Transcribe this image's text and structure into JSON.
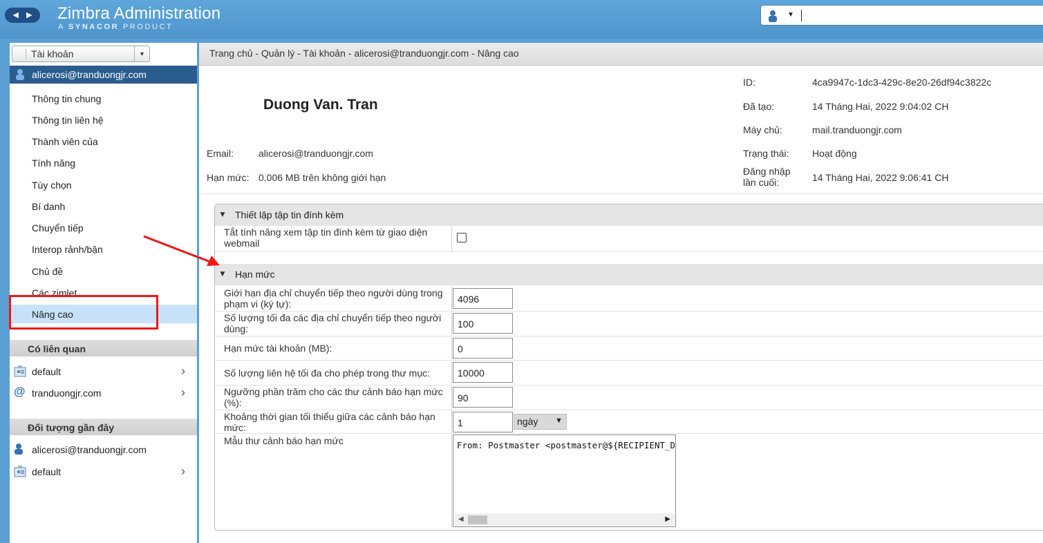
{
  "header": {
    "title": "Zimbra Administration",
    "subtitle_prefix": "A",
    "subtitle_brand": "SYNACOR",
    "subtitle_suffix": "PRODUCT",
    "search_value": ""
  },
  "sidebar": {
    "view_select": "Tài khoản",
    "account": "alicerosi@tranduongjr.com",
    "items": [
      {
        "label": "Thông tin chung"
      },
      {
        "label": "Thông tin liên hệ"
      },
      {
        "label": "Thành viên của"
      },
      {
        "label": "Tính năng"
      },
      {
        "label": "Tùy chọn"
      },
      {
        "label": "Bí danh"
      },
      {
        "label": "Chuyển tiếp"
      },
      {
        "label": "Interop rảnh/bận"
      },
      {
        "label": "Chủ đề"
      },
      {
        "label": "Các zimlet"
      },
      {
        "label": "Nâng cao"
      }
    ],
    "related_title": "Có liên quan",
    "related": [
      {
        "label": "default",
        "icon": "cos-icon"
      },
      {
        "label": "tranduongjr.com",
        "icon": "at-domain-icon"
      }
    ],
    "recent_title": "Đối tượng gần đây",
    "recent": [
      {
        "label": "alicerosi@tranduongjr.com",
        "icon": "user-icon"
      },
      {
        "label": "default",
        "icon": "cos-icon"
      }
    ]
  },
  "main": {
    "breadcrumb": "Trang chủ - Quản lý - Tài khoản - alicerosi@tranduongjr.com - Nâng cao",
    "full_name": "Duong Van. Tran",
    "email_label": "Email:",
    "email_value": "alicerosi@tranduongjr.com",
    "quota_label": "Hạn mức:",
    "quota_value": "0.006 MB trên không giới hạn",
    "id_label": "ID:",
    "id_value": "4ca9947c-1dc3-429c-8e20-26df94c3822c",
    "created_label": "Đã tạo:",
    "created_value": "14 Tháng Hai, 2022 9:04:02 CH",
    "server_label": "Máy chủ:",
    "server_value": "mail.tranduongjr.com",
    "status_label": "Trạng thái:",
    "status_value": "Hoạt động",
    "lastlogin_label_1": "Đăng nhập",
    "lastlogin_label_2": "lần cuối:",
    "lastlogin_value": "14 Tháng Hai, 2022 9:06:41 CH",
    "attach_section": {
      "title": "Thiết lập tập tin đính kèm",
      "disable_label": "Tắt tính năng xem tập tin đính kèm từ giao diện webmail",
      "disable_checked": false
    },
    "quota_section": {
      "title": "Hạn mức",
      "fields": [
        {
          "label": "Giới hạn địa chỉ chuyển tiếp theo người dùng trong phạm vi (ký tự):",
          "value": "4096"
        },
        {
          "label": "Số lượng tối đa các địa chỉ chuyển tiếp theo người dùng:",
          "value": "100"
        },
        {
          "label": "Hạn mức tài khoản (MB):",
          "value": "0"
        },
        {
          "label": "Số lượng liên hệ tối đa cho phép trong thư mục:",
          "value": "10000"
        },
        {
          "label": "Ngưỡng phần trăm cho các thư cảnh báo hạn mức (%):",
          "value": "90"
        },
        {
          "label": "Khoảng thời gian tối thiểu giữa các cảnh báo hạn mức:",
          "value": "1"
        }
      ],
      "interval_unit": "ngày",
      "template_label": "Mẫu thư cảnh báo hạn mức",
      "template_value": "From: Postmaster <postmaster@${RECIPIENT_DOMAIN}>"
    }
  },
  "colors": {
    "header_bg": "#5a9fd4",
    "selected_account_bg": "#2b5c8e",
    "selected_nav_bg": "#c7e2f8",
    "annotation_red": "#f21515"
  }
}
